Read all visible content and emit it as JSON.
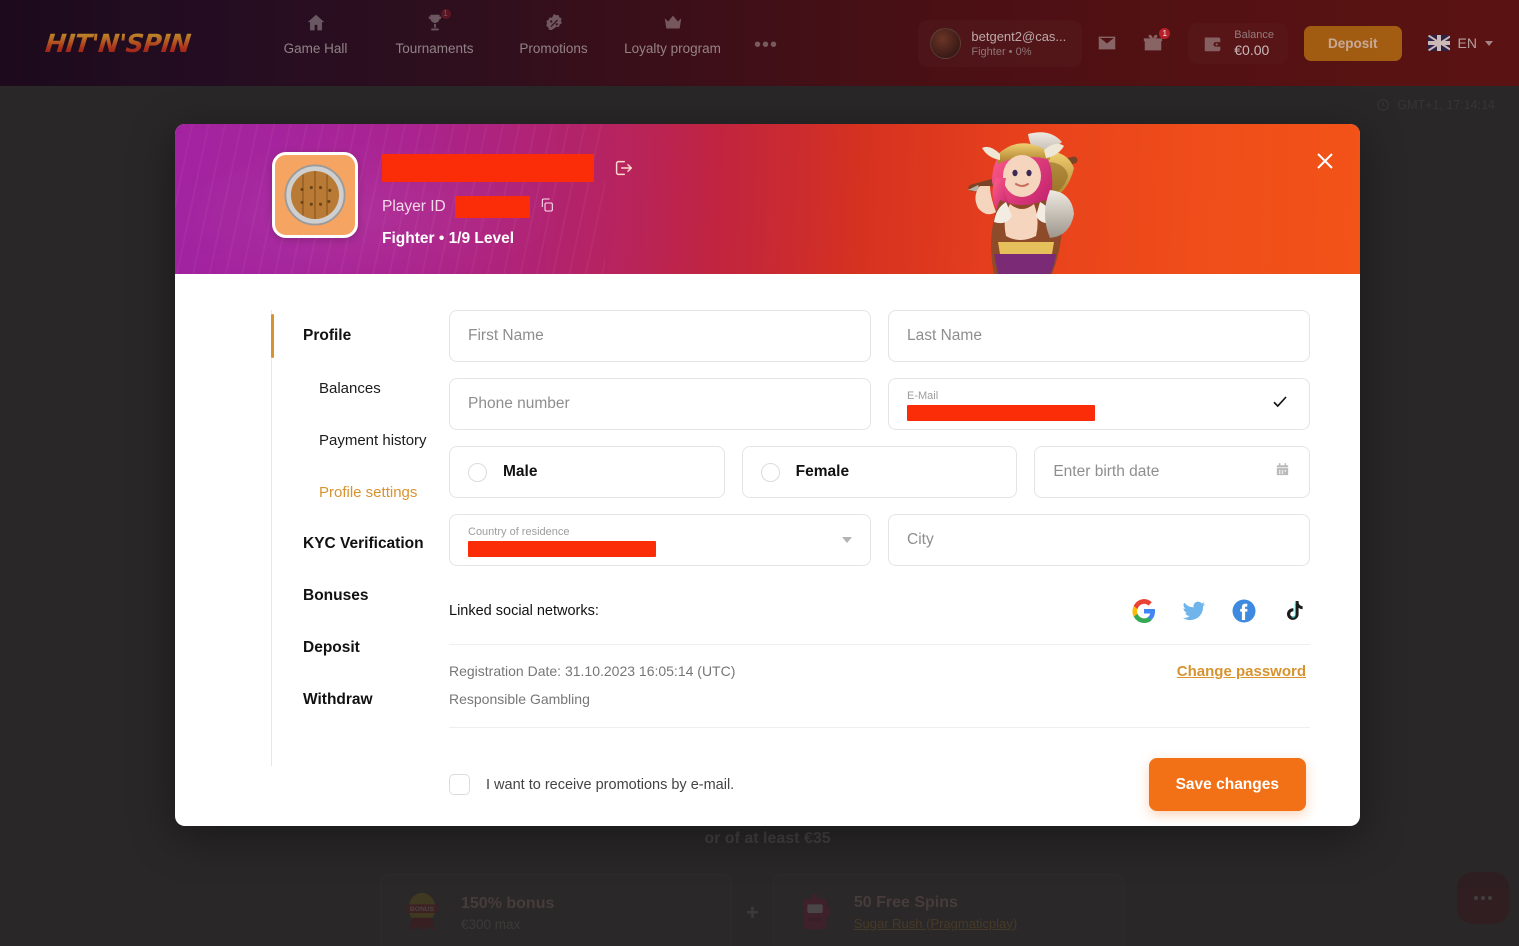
{
  "header": {
    "logo_text": "HIT'N'SPIN",
    "nav": [
      {
        "label": "Game Hall",
        "icon": "home-icon",
        "badge": null
      },
      {
        "label": "Tournaments",
        "icon": "trophy-icon",
        "badge": "1"
      },
      {
        "label": "Promotions",
        "icon": "percent-badge-icon",
        "badge": null
      },
      {
        "label": "Loyalty program",
        "icon": "crown-icon",
        "badge": null
      }
    ],
    "more_label": "•••",
    "user": {
      "name": "betgent2@cas...",
      "sub": "Fighter • 0%"
    },
    "mail_icon": "envelope-icon",
    "gift_icon": "gift-icon",
    "gift_badge": "1",
    "balance_label": "Balance",
    "balance_value": "€0.00",
    "deposit_label": "Deposit",
    "language": "EN"
  },
  "status_bar": {
    "timezone": "GMT+1, 17:14:14"
  },
  "modal": {
    "close_label": "×",
    "banner": {
      "nickname_redacted": true,
      "player_id_label": "Player ID",
      "player_id_redacted": true,
      "level_text": "Fighter • 1/9 Level",
      "avatar_icon": "wooden-shield-avatar",
      "logout_icon": "logout-icon",
      "copy_icon": "copy-icon"
    },
    "sidebar": [
      {
        "label": "Profile",
        "type": "root",
        "active": true
      },
      {
        "label": "Balances",
        "type": "sub",
        "active": false
      },
      {
        "label": "Payment history",
        "type": "sub",
        "active": false
      },
      {
        "label": "Profile settings",
        "type": "sub",
        "active": true
      },
      {
        "label": "KYC Verification",
        "type": "root",
        "active": false
      },
      {
        "label": "Bonuses",
        "type": "root",
        "active": false
      },
      {
        "label": "Deposit",
        "type": "root",
        "active": false
      },
      {
        "label": "Withdraw",
        "type": "root",
        "active": false
      }
    ],
    "form": {
      "first_name_placeholder": "First Name",
      "first_name_value": "",
      "last_name_placeholder": "Last Name",
      "last_name_value": "",
      "phone_placeholder": "Phone number",
      "phone_value": "",
      "email_label": "E-Mail",
      "email_value_redacted": true,
      "email_verified": true,
      "gender_male": "Male",
      "gender_female": "Female",
      "gender_selected": "",
      "birth_date_placeholder": "Enter birth date",
      "birth_date_value": "",
      "country_label": "Country of residence",
      "country_value_redacted": true,
      "city_placeholder": "City",
      "city_value": ""
    },
    "social": {
      "label": "Linked social networks:",
      "networks": [
        "google-icon",
        "twitter-icon",
        "facebook-icon",
        "tiktok-icon"
      ]
    },
    "meta": {
      "registration_date": "Registration Date: 31.10.2023 16:05:14 (UTC)",
      "responsible_gambling": "Responsible Gambling",
      "change_password": "Change password"
    },
    "footer": {
      "promo_checkbox_label": "I want to receive promotions by e-mail.",
      "promo_checked": false,
      "save_label": "Save changes"
    }
  },
  "background_promo": {
    "heading": "or of at least €35",
    "plus": "+",
    "cards": [
      {
        "title": "150% bonus",
        "sub": "€300 max",
        "link": "",
        "icon": "bonus-ribbon-icon"
      },
      {
        "title": "50 Free Spins",
        "sub": "",
        "link": "Sugar Rush (Pragmaticplay)",
        "icon": "slot-machine-icon"
      }
    ]
  },
  "chat": {
    "icon": "chat-dots-icon"
  },
  "colors": {
    "accent_orange": "#f27116",
    "link_gold": "#d8932f",
    "redaction": "#fb2d09",
    "banner_left": "#9a1fa0",
    "banner_right": "#f25317"
  }
}
